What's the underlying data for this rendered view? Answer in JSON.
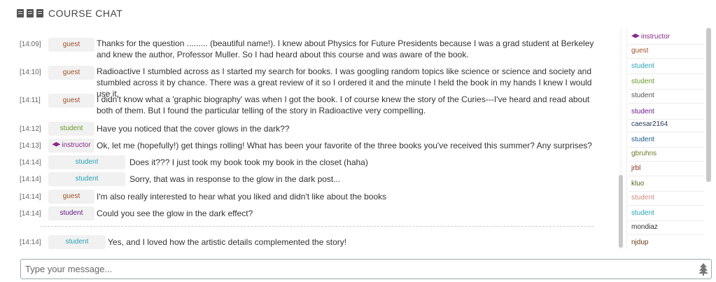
{
  "header": {
    "title": "COURSE CHAT",
    "icon": "book-icon"
  },
  "messages": [
    {
      "time": "[14:09]",
      "role": "guest",
      "text": "Thanks for the question ......... (beautiful name!).  I knew about Physics for Future Presidents because I was a grad student at Berkeley and knew the author, Professor Muller.  So I had heard about this course and was aware of the book."
    },
    {
      "time": "[14:10]",
      "role": "guest",
      "text": "Radioactive I stumbled across as I started my search for books.  I was googling random topics like science or science and society and stumbled across it by chance.  There was a great review of it so I ordered it and the minute I held the book in my hands I knew I would use it."
    },
    {
      "time": "[14:11]",
      "role": "guest",
      "text": "I didn't know what a 'graphic biography' was when I got the book.  I of course knew the story of the Curies---I've heard and read about both of them.  But I found the particular telling of the story in Radioactive very compelling."
    },
    {
      "time": "[14:12]",
      "role": "student",
      "text": "Have you noticed that the cover glows in the dark??"
    },
    {
      "time": "[14:13]",
      "role": "instructor",
      "text": "Ok, let me (hopefully!) get things rolling! What has been your favorite of the three books you've received this summer? Any surprises?"
    },
    {
      "time": "[14:14]",
      "role": "student",
      "text": "Does it??? I just took my book took my book in the closet (haha)"
    },
    {
      "time": "[14:14]",
      "role": "student",
      "text": "Sorry, that was in response to the glow in the dark post..."
    },
    {
      "time": "[14:14]",
      "role": "guest",
      "text": "I'm also really interested to hear what you liked and didn't like about the books"
    },
    {
      "time": "[14:14]",
      "role": "student",
      "text": "Could you see the glow in the dark effect?"
    },
    {
      "time": "[14:14]",
      "role": "student",
      "text": "Yes, and I loved how the artistic details complemented the story!"
    }
  ],
  "roster": [
    {
      "name": "instructor",
      "icon": "graduation-cap-icon"
    },
    {
      "name": "guest"
    },
    {
      "name": "student"
    },
    {
      "name": "student"
    },
    {
      "name": "student"
    },
    {
      "name": "student"
    },
    {
      "name": "caesar2164"
    },
    {
      "name": "student"
    },
    {
      "name": "gbruhns"
    },
    {
      "name": "jrbl"
    },
    {
      "name": "kluo"
    },
    {
      "name": "student"
    },
    {
      "name": "student"
    },
    {
      "name": "mondiaz"
    },
    {
      "name": "njdup"
    }
  ],
  "composer": {
    "placeholder": "Type your message...",
    "value": ""
  },
  "colors": {
    "guest": "#a0522d",
    "student_teal": "#2aa3b8",
    "student_green": "#6a9a2a",
    "student_purple": "#6a1a8a",
    "instructor": "#8a2a8a"
  }
}
